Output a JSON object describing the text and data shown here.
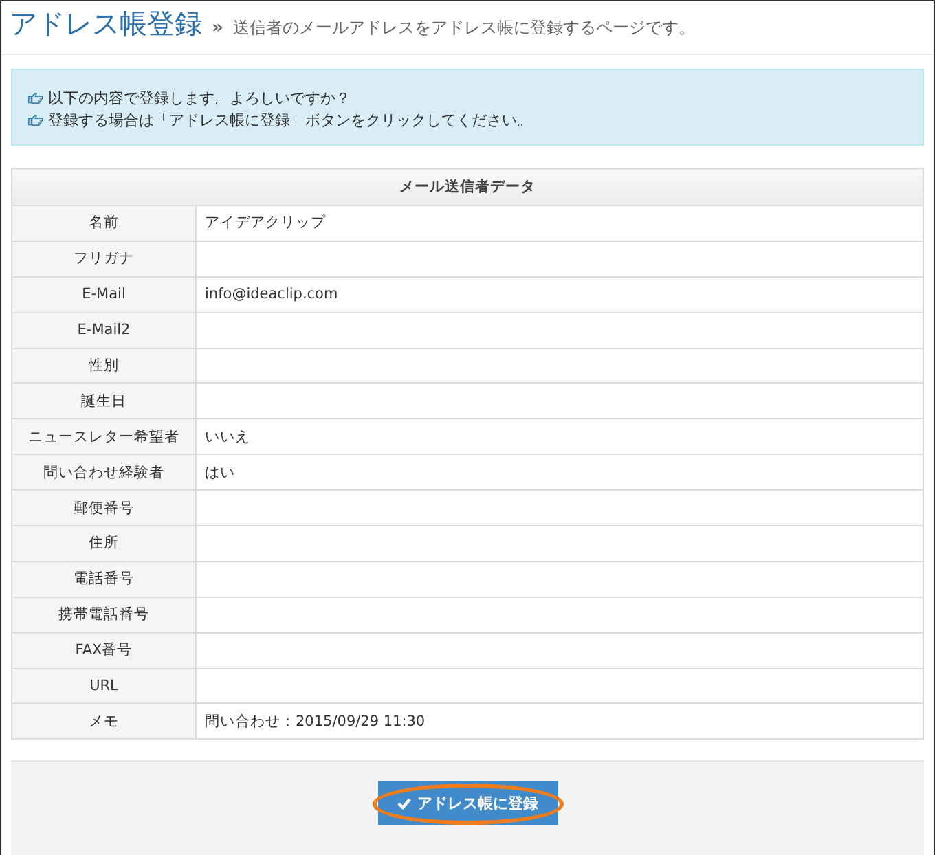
{
  "header": {
    "title": "アドレス帳登録",
    "separator": "»",
    "description": "送信者のメールアドレスをアドレス帳に登録するページです。"
  },
  "notice": {
    "lines": [
      "以下の内容で登録します。よろしいですか？",
      "登録する場合は「アドレス帳に登録」ボタンをクリックしてください。"
    ]
  },
  "table": {
    "caption": "メール送信者データ",
    "rows": [
      {
        "label": "名前",
        "value": "アイデアクリップ"
      },
      {
        "label": "フリガナ",
        "value": ""
      },
      {
        "label": "E-Mail",
        "value": "info@ideaclip.com"
      },
      {
        "label": "E-Mail2",
        "value": ""
      },
      {
        "label": "性別",
        "value": ""
      },
      {
        "label": "誕生日",
        "value": ""
      },
      {
        "label": "ニュースレター希望者",
        "value": "いいえ"
      },
      {
        "label": "問い合わせ経験者",
        "value": "はい"
      },
      {
        "label": "郵便番号",
        "value": ""
      },
      {
        "label": "住所",
        "value": ""
      },
      {
        "label": "電話番号",
        "value": ""
      },
      {
        "label": "携帯電話番号",
        "value": ""
      },
      {
        "label": "FAX番号",
        "value": ""
      },
      {
        "label": "URL",
        "value": ""
      },
      {
        "label": "メモ",
        "value": "問い合わせ：2015/09/29 11:30"
      }
    ]
  },
  "footer": {
    "button": {
      "label": "アドレス帳に登録",
      "highlighted": true
    }
  }
}
